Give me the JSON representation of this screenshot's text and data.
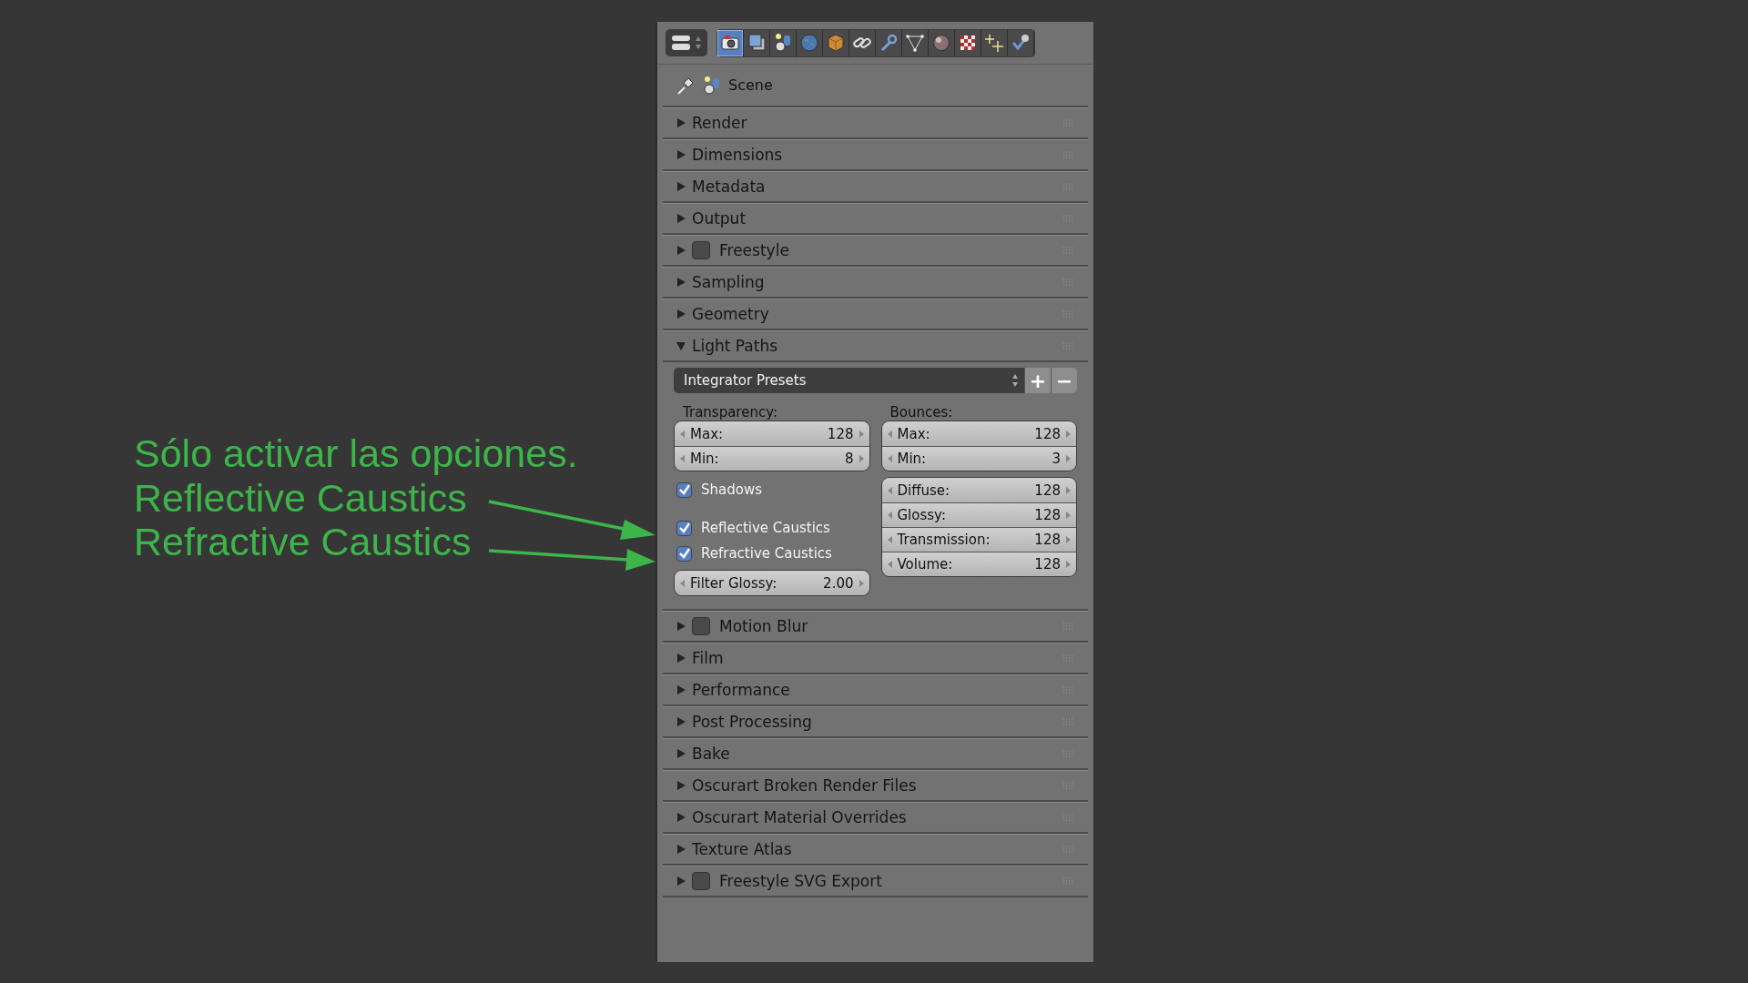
{
  "annotation": {
    "lines": [
      "Sólo activar las opciones.",
      "Reflective Caustics",
      "Refractive Caustics"
    ]
  },
  "header": {
    "tabs": [
      {
        "selected": true
      },
      {
        "selected": false
      },
      {
        "selected": false
      },
      {
        "selected": false
      },
      {
        "selected": false
      },
      {
        "selected": false
      },
      {
        "selected": false
      },
      {
        "selected": false
      },
      {
        "selected": false
      },
      {
        "selected": false
      },
      {
        "selected": false
      },
      {
        "selected": false
      }
    ]
  },
  "context": {
    "label": "Scene"
  },
  "panels": [
    {
      "title": "Render",
      "kind": "plain",
      "expanded": false
    },
    {
      "title": "Dimensions",
      "kind": "plain",
      "expanded": false
    },
    {
      "title": "Metadata",
      "kind": "plain",
      "expanded": false
    },
    {
      "title": "Output",
      "kind": "plain",
      "expanded": false
    },
    {
      "title": "Freestyle",
      "kind": "toggle",
      "checked": false,
      "expanded": false
    },
    {
      "title": "Sampling",
      "kind": "plain",
      "expanded": false
    },
    {
      "title": "Geometry",
      "kind": "plain",
      "expanded": false
    },
    {
      "title": "Light Paths",
      "kind": "plain",
      "expanded": true,
      "content": {
        "presets": {
          "value": "Integrator Presets",
          "add": "+",
          "remove": "−"
        },
        "transparency": {
          "label": "Transparency:",
          "fields": [
            {
              "label": "Max:",
              "value": "128"
            },
            {
              "label": "Min:",
              "value": "8"
            }
          ]
        },
        "checkboxes": [
          {
            "label": "Shadows",
            "checked": true
          },
          {
            "label": "Reflective Caustics",
            "checked": true
          },
          {
            "label": "Refractive Caustics",
            "checked": true
          }
        ],
        "filter_glossy": {
          "label": "Filter Glossy:",
          "value": "2.00"
        },
        "bounces": {
          "label": "Bounces:",
          "fields": [
            {
              "label": "Max:",
              "value": "128"
            },
            {
              "label": "Min:",
              "value": "3"
            }
          ],
          "fields_2": [
            {
              "label": "Diffuse:",
              "value": "128"
            },
            {
              "label": "Glossy:",
              "value": "128"
            },
            {
              "label": "Transmission:",
              "value": "128"
            },
            {
              "label": "Volume:",
              "value": "128"
            }
          ]
        }
      }
    },
    {
      "title": "Motion Blur",
      "kind": "toggle",
      "checked": false,
      "expanded": false
    },
    {
      "title": "Film",
      "kind": "plain",
      "expanded": false
    },
    {
      "title": "Performance",
      "kind": "plain",
      "expanded": false
    },
    {
      "title": "Post Processing",
      "kind": "plain",
      "expanded": false
    },
    {
      "title": "Bake",
      "kind": "plain",
      "expanded": false
    },
    {
      "title": "Oscurart Broken Render Files",
      "kind": "plain",
      "expanded": false
    },
    {
      "title": "Oscurart Material Overrides",
      "kind": "plain",
      "expanded": false
    },
    {
      "title": "Texture Atlas",
      "kind": "plain",
      "expanded": false
    },
    {
      "title": "Freestyle SVG Export",
      "kind": "toggle",
      "checked": false,
      "expanded": false
    }
  ]
}
